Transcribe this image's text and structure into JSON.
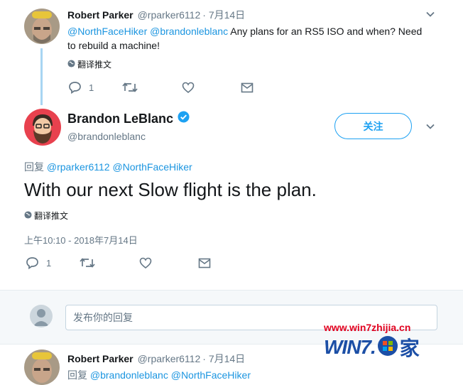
{
  "tweet1": {
    "name": "Robert Parker",
    "handle": "@rparker6112",
    "date": "· 7月14日",
    "mention1": "@NorthFaceHiker",
    "mention2": "@brandonleblanc",
    "text_line1": " Any plans for an RS5 ISO and when? Need",
    "text_line2": "to rebuild a machine!",
    "translate": "翻译推文",
    "reply_count": "1",
    "icons": [
      "reply-icon",
      "retweet-icon",
      "like-icon",
      "dm-icon",
      "chevron-down-icon",
      "globe-icon"
    ]
  },
  "tweet2": {
    "name": "Brandon LeBlanc",
    "handle": "@brandonleblanc",
    "follow_label": "关注",
    "reply_prefix": "回复 ",
    "reply_to": "@rparker6112 @NorthFaceHiker",
    "text": "With our next Slow flight is the plan.",
    "translate": "翻译推文",
    "timestamp": "上午10:10 - 2018年7月14日",
    "reply_count": "1",
    "icons": [
      "verified-icon",
      "reply-icon",
      "retweet-icon",
      "like-icon",
      "dm-icon",
      "chevron-down-icon",
      "globe-icon"
    ]
  },
  "reply_box": {
    "placeholder": "发布你的回复"
  },
  "tweet3": {
    "name": "Robert Parker",
    "handle": "@rparker6112",
    "date": "· 7月14日",
    "reply_prefix": "回复 ",
    "reply_to": "@brandonleblanc @NorthFaceHiker"
  },
  "watermark": {
    "url": "www.win7zhijia.cn",
    "logo_text": "WIN7.",
    "logo_suffix": "家"
  },
  "colors": {
    "accent": "#1da1f2",
    "link": "#1b95e0",
    "muted": "#657786",
    "thread_line": "#a8d5f2",
    "watermark_red": "#e1001e",
    "watermark_blue": "#1c4fa6"
  }
}
